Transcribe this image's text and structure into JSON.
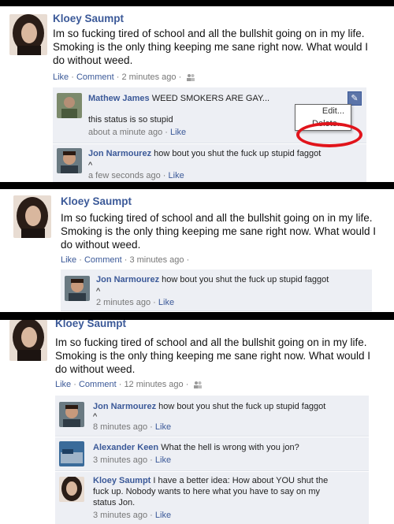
{
  "panel1": {
    "post": {
      "author": "Kloey Saumpt",
      "text": "Im so fucking tired of school and all the bullshit going on in my life. Smoking is the only thing keeping me sane right now. What would I do without weed.",
      "like_label": "Like",
      "comment_label": "Comment",
      "time": "2 minutes ago"
    },
    "comments": [
      {
        "author": "Mathew James",
        "text_line1": "WEED SMOKERS ARE GAY...",
        "text_line2": "this status is so stupid",
        "time": "about a minute ago",
        "like_label": "Like"
      },
      {
        "author": "Jon Narmourez",
        "text_line1": "how bout you shut the fuck up stupid faggot",
        "text_line2": "^",
        "time": "a few seconds ago",
        "like_label": "Like"
      }
    ],
    "menu": {
      "edit_label": "Edit...",
      "delete_label": "Delete...",
      "pencil_icon": "pencil-icon"
    }
  },
  "panel2": {
    "post": {
      "author": "Kloey Saumpt",
      "text": "Im so fucking tired of school and all the bullshit going on in my life. Smoking is the only thing keeping me sane right now. What would I do without weed.",
      "like_label": "Like",
      "comment_label": "Comment",
      "time": "3 minutes ago"
    },
    "comments": [
      {
        "author": "Jon Narmourez",
        "text_line1": "how bout you shut the fuck up stupid faggot",
        "text_line2": "^",
        "time": "2 minutes ago",
        "like_label": "Like"
      }
    ]
  },
  "panel3": {
    "post": {
      "author": "Kloey Saumpt",
      "text": "Im so fucking tired of school and all the bullshit going on in my life. Smoking is the only thing keeping me sane right now. What would I do without weed.",
      "like_label": "Like",
      "comment_label": "Comment",
      "time": "12 minutes ago"
    },
    "comments": [
      {
        "author": "Jon Narmourez",
        "text_line1": "how bout you shut the fuck up stupid faggot",
        "text_line2": "^",
        "time": "8 minutes ago",
        "like_label": "Like"
      },
      {
        "author": "Alexander Keen",
        "text_line1": "What the hell is wrong with you jon?",
        "time": "3 minutes ago",
        "like_label": "Like"
      },
      {
        "author": "Kloey Saumpt",
        "text_line1": "I have a better idea: How about YOU shut the",
        "text_line2": "fuck up. Nobody wants to here what you have to say on my",
        "text_line3": "status Jon.",
        "time": "3 minutes ago",
        "like_label": "Like"
      }
    ]
  },
  "colors": {
    "link": "#3b5998",
    "comment_bg": "#edeff4",
    "highlight": "#e1141b"
  }
}
